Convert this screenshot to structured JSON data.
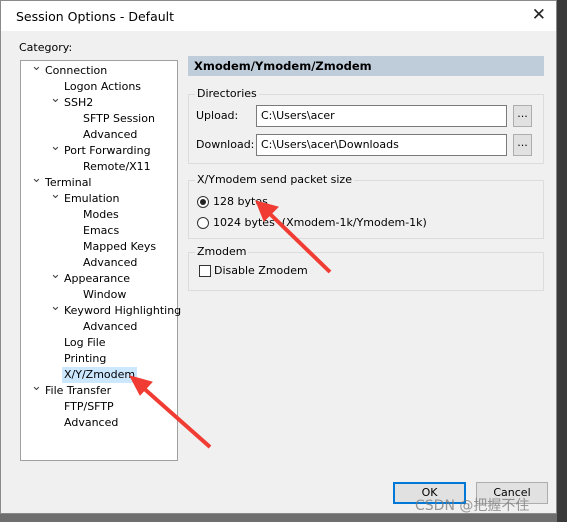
{
  "window": {
    "title": "Session Options - Default",
    "close": "✕"
  },
  "category_label": "Category:",
  "tree": [
    {
      "label": "Connection",
      "level": 0,
      "chevron": true
    },
    {
      "label": "Logon Actions",
      "level": 1
    },
    {
      "label": "SSH2",
      "level": 1,
      "chevron": true
    },
    {
      "label": "SFTP Session",
      "level": 2
    },
    {
      "label": "Advanced",
      "level": 2
    },
    {
      "label": "Port Forwarding",
      "level": 1,
      "chevron": true
    },
    {
      "label": "Remote/X11",
      "level": 2
    },
    {
      "label": "Terminal",
      "level": 0,
      "chevron": true
    },
    {
      "label": "Emulation",
      "level": 1,
      "chevron": true
    },
    {
      "label": "Modes",
      "level": 2
    },
    {
      "label": "Emacs",
      "level": 2
    },
    {
      "label": "Mapped Keys",
      "level": 2
    },
    {
      "label": "Advanced",
      "level": 2
    },
    {
      "label": "Appearance",
      "level": 1,
      "chevron": true
    },
    {
      "label": "Window",
      "level": 2
    },
    {
      "label": "Keyword Highlighting",
      "level": 1,
      "chevron": true
    },
    {
      "label": "Advanced",
      "level": 2
    },
    {
      "label": "Log File",
      "level": 1
    },
    {
      "label": "Printing",
      "level": 1
    },
    {
      "label": "X/Y/Zmodem",
      "level": 1,
      "selected": true
    },
    {
      "label": "File Transfer",
      "level": 0,
      "chevron": true
    },
    {
      "label": "FTP/SFTP",
      "level": 1
    },
    {
      "label": "Advanced",
      "level": 1
    }
  ],
  "panel": {
    "header": "Xmodem/Ymodem/Zmodem",
    "directories": {
      "label": "Directories",
      "upload_label": "Upload:",
      "upload_value": "C:\\Users\\acer",
      "download_label": "Download:",
      "download_value": "C:\\Users\\acer\\Downloads",
      "browse": "..."
    },
    "packet": {
      "label": "X/Ymodem send packet size",
      "opt1": "128 bytes",
      "opt2": "1024 bytes  (Xmodem-1k/Ymodem-1k)",
      "selected": "128 bytes"
    },
    "zmodem": {
      "label": "Zmodem",
      "disable": "Disable Zmodem",
      "checked": false
    }
  },
  "buttons": {
    "ok": "OK",
    "cancel": "Cancel"
  },
  "watermark": "CSDN @把握不住",
  "annotation_color": "#f03c32"
}
